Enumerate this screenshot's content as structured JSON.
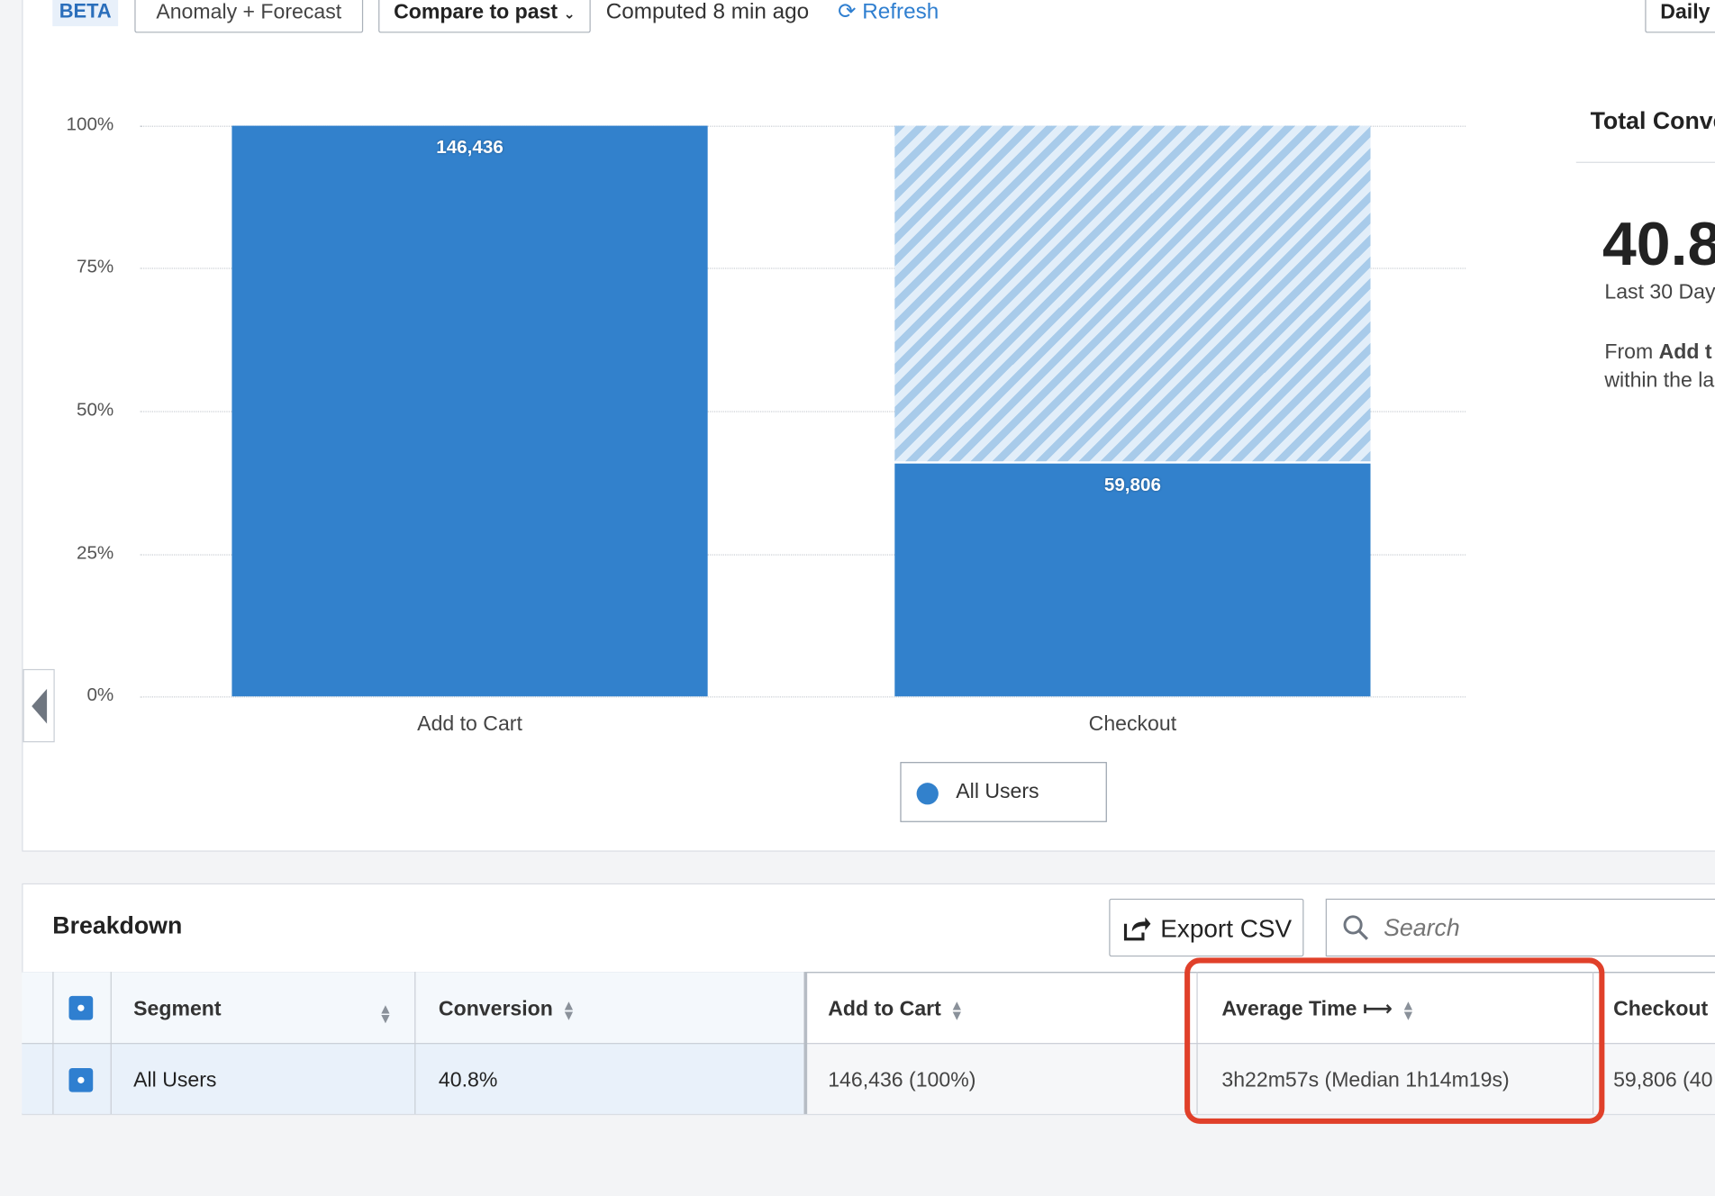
{
  "toolbar": {
    "beta_badge": "BETA",
    "anomaly_label": "Anomaly + Forecast",
    "compare_label": "Compare to past",
    "computed_text": "Computed 8 min ago",
    "refresh_label": "Refresh",
    "interval_label": "Daily"
  },
  "chart_data": {
    "type": "bar",
    "categories": [
      "Add to Cart",
      "Checkout"
    ],
    "values": [
      100,
      40.8
    ],
    "value_labels": [
      "146,436",
      "59,806"
    ],
    "y_ticks": [
      "100%",
      "75%",
      "50%",
      "25%",
      "0%"
    ],
    "ylim": [
      0,
      100
    ],
    "series": [
      {
        "name": "All Users",
        "values": [
          100,
          40.8
        ]
      }
    ],
    "dropoff_style": "hatched"
  },
  "legend": {
    "item": "All Users"
  },
  "summary": {
    "title": "Total Conve",
    "value": "40.8",
    "period": "Last 30 Day",
    "desc_prefix": "From ",
    "desc_bold": "Add t",
    "desc_line2": "within the la"
  },
  "breakdown": {
    "title": "Breakdown",
    "export_label": "Export CSV",
    "search_placeholder": "Search",
    "columns": {
      "segment": "Segment",
      "conversion": "Conversion",
      "add_to_cart": "Add to Cart",
      "avg_time": "Average Time ⟼",
      "checkout": "Checkout"
    },
    "rows": [
      {
        "segment": "All Users",
        "conversion": "40.8%",
        "add_to_cart": "146,436 (100%)",
        "avg_time": "3h22m57s (Median 1h14m19s)",
        "checkout": "59,806 (40"
      }
    ]
  },
  "colors": {
    "bar": "#3281cc",
    "accent": "#2f7fd0",
    "highlight": "#e0402a"
  }
}
